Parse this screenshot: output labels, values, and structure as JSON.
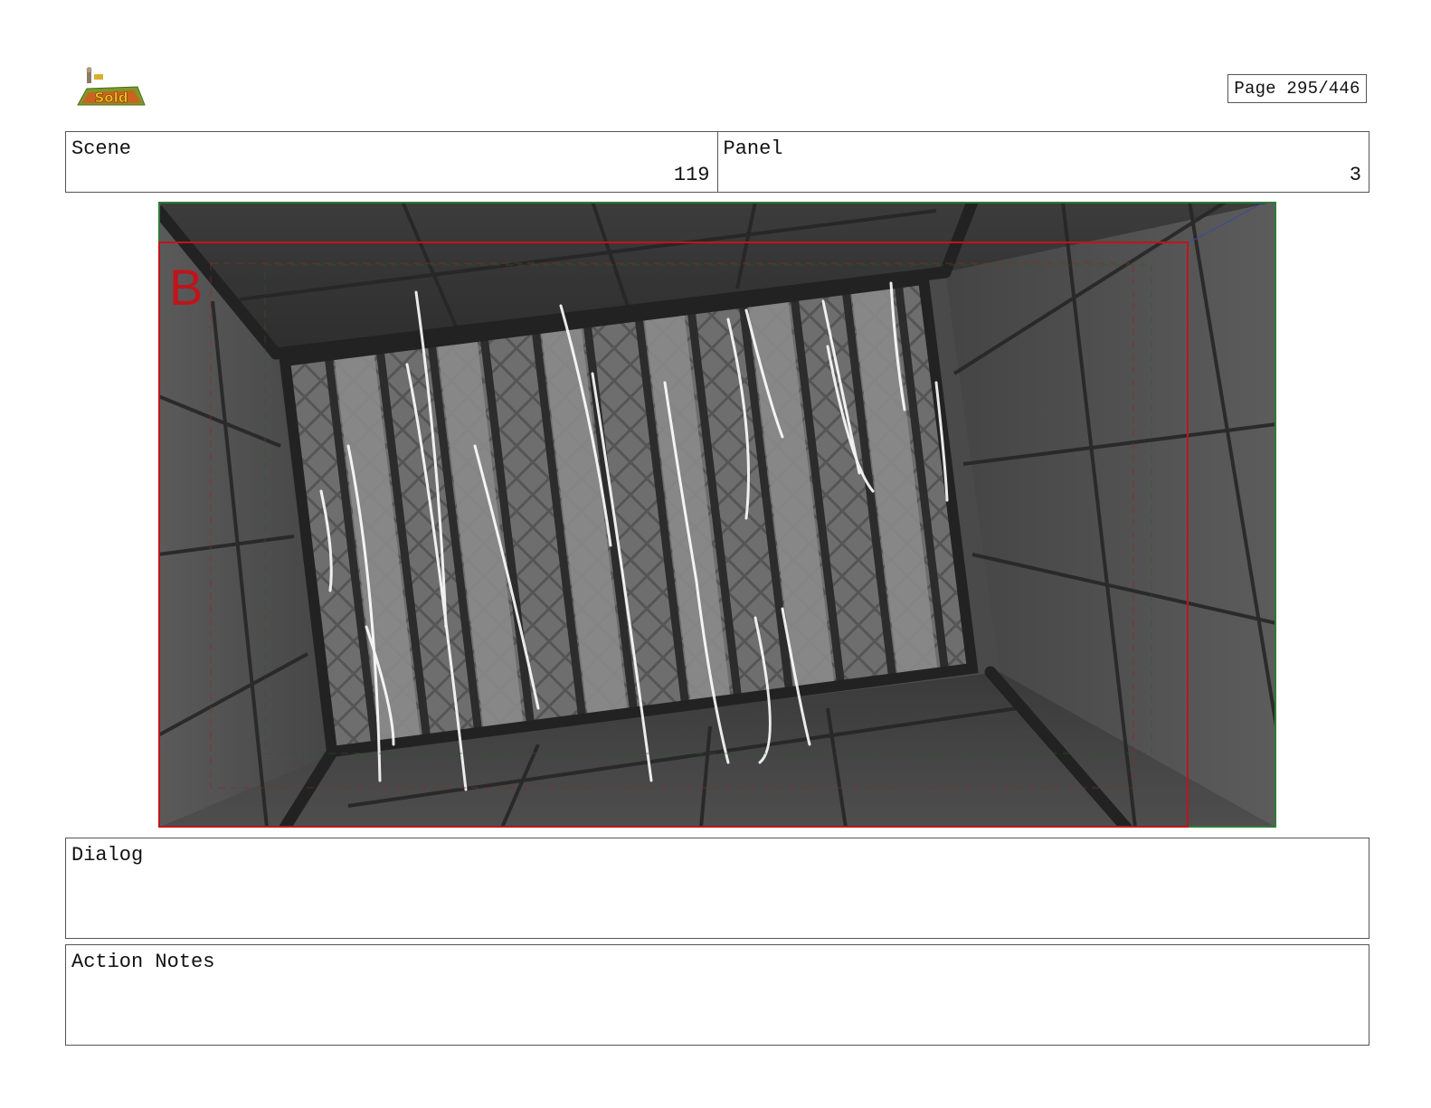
{
  "page": {
    "label": "Page 295/446"
  },
  "logo": {
    "icon": "show-logo-icon",
    "colors": {
      "grass": "#7a9a2a",
      "ground": "#c8641e",
      "text": "#f0c21a"
    }
  },
  "scene": {
    "label": "Scene",
    "value": "119"
  },
  "panel": {
    "label": "Panel",
    "value": "3"
  },
  "frame": {
    "layer_marker": "B",
    "colors": {
      "safe_frame": "#c0141a",
      "outer_frame": "#2e7a3a",
      "background": "#4a4a4a"
    }
  },
  "dialog": {
    "label": "Dialog",
    "text": ""
  },
  "action_notes": {
    "label": "Action Notes",
    "text": ""
  }
}
